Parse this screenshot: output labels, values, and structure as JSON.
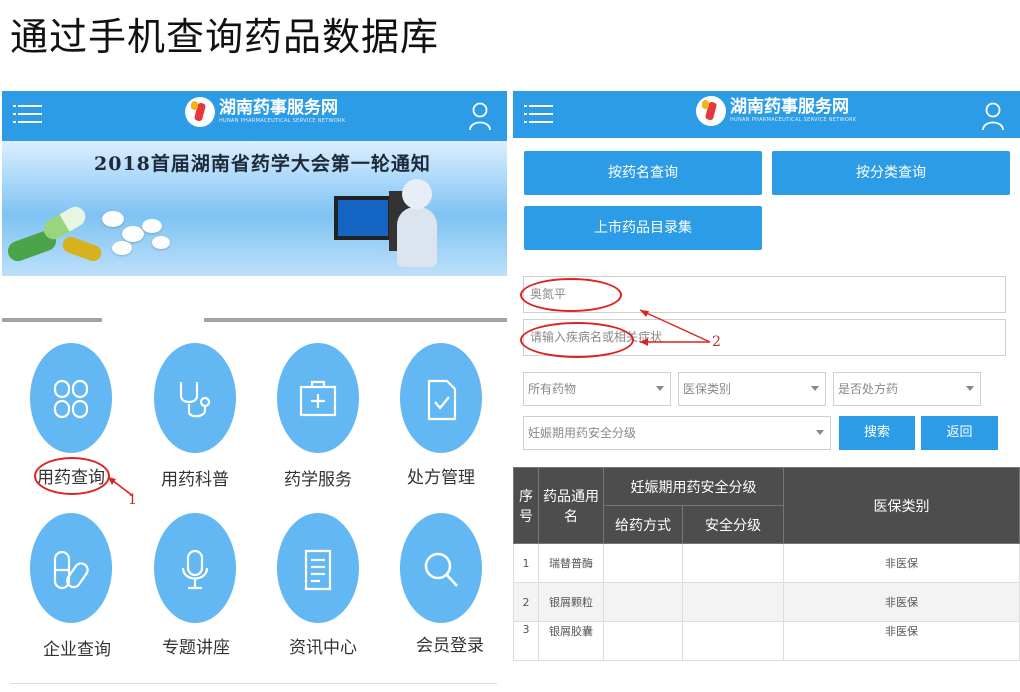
{
  "slide_title": "通过手机查询药品数据库",
  "site": {
    "name_cn": "湖南药事服务网",
    "name_en": "HUNAN PHARMACEUTICAL SERVICE NETWORK"
  },
  "left_phone": {
    "banner_text": "2018首届湖南省药学大会第一轮通知",
    "grid": [
      {
        "label": "用药查询",
        "icon": "pill-clover-icon"
      },
      {
        "label": "用药科普",
        "icon": "stethoscope-icon"
      },
      {
        "label": "药学服务",
        "icon": "medical-kit-icon"
      },
      {
        "label": "处方管理",
        "icon": "prescription-check-icon"
      },
      {
        "label": "企业查询",
        "icon": "capsule-icon"
      },
      {
        "label": "专题讲座",
        "icon": "microphone-icon"
      },
      {
        "label": "资讯中心",
        "icon": "document-icon"
      },
      {
        "label": "会员登录",
        "icon": "search-icon"
      }
    ],
    "annotation": "1"
  },
  "right_phone": {
    "buttons": {
      "by_name": "按药名查询",
      "by_category": "按分类查询",
      "catalog": "上市药品目录集"
    },
    "drug_input_value": "奥氮平",
    "disease_placeholder": "请输入疾病名或相关症状",
    "filters": {
      "all_drugs": "所有药物",
      "insurance_type": "医保类别",
      "prescription": "是否处方药",
      "pregnancy": "妊娠期用药安全分级"
    },
    "search_label": "搜索",
    "back_label": "返回",
    "annotation": "2",
    "table": {
      "col_no": "序号",
      "col_name": "药品通用名",
      "col_pregnancy": "妊娠期用药安全分级",
      "col_route": "给药方式",
      "col_level": "安全分级",
      "col_insurance": "医保类别",
      "rows": [
        {
          "no": "1",
          "name": "瑞替普酶",
          "route": "",
          "level": "",
          "insurance": "非医保"
        },
        {
          "no": "2",
          "name": "银屑颗粒",
          "route": "",
          "level": "",
          "insurance": "非医保"
        },
        {
          "no": "3",
          "name": "银屑胶囊",
          "route": "",
          "level": "",
          "insurance": "非医保"
        }
      ]
    }
  },
  "colors": {
    "brand_blue": "#2d9ce6",
    "icon_blue": "#63b7f3",
    "annotation_red": "#d22222",
    "table_header": "#4d4d4d"
  }
}
